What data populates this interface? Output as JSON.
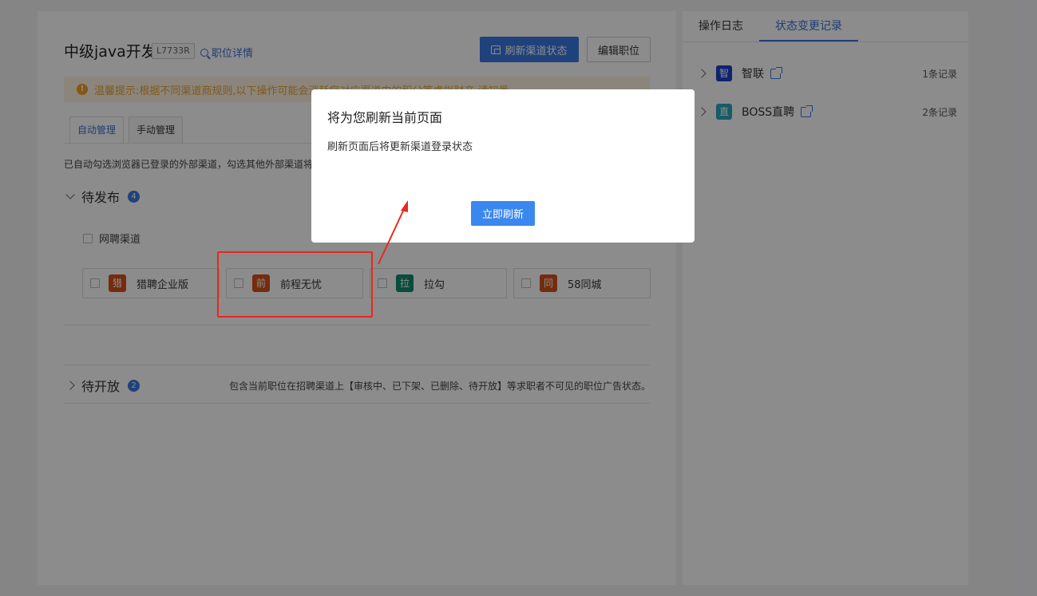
{
  "job": {
    "title": "中级java开发",
    "code": "L7733R",
    "detail_link": "职位详情",
    "refresh_button": "刷新渠道状态",
    "edit_button": "编辑职位"
  },
  "warning": {
    "text": "温馨提示:根据不同渠道商规则,以下操作可能会消耗您对应渠道中的积分等虚拟财产,请知悉。"
  },
  "tabs": [
    {
      "label": "自动管理",
      "active": true
    },
    {
      "label": "手动管理",
      "active": false
    }
  ],
  "auto_hint": "已自动勾选浏览器已登录的外部渠道，勾选其他外部渠道将",
  "pending": {
    "title": "待发布",
    "count": "4",
    "group_label": "网聘渠道",
    "channels": [
      {
        "icon": "猎",
        "name": "猎聘企业版",
        "color": "#d4501a"
      },
      {
        "icon": "前",
        "name": "前程无忧",
        "color": "#d4501a"
      },
      {
        "icon": "拉",
        "name": "拉勾",
        "color": "#0f8a6c"
      },
      {
        "icon": "同",
        "name": "58同城",
        "color": "#d4501a"
      }
    ]
  },
  "closed": {
    "title": "待开放",
    "count": "2",
    "description": "包含当前职位在招聘渠道上【审核中、已下架、已删除、待开放】等求职者不可见的职位广告状态。"
  },
  "side": {
    "tabs": [
      {
        "label": "操作日志",
        "active": false
      },
      {
        "label": "状态变更记录",
        "active": true
      }
    ],
    "records": [
      {
        "logo": "智",
        "name": "智联",
        "count": "1条记录",
        "color": "#1a3fc8"
      },
      {
        "logo": "直",
        "name": "BOSS直聘",
        "count": "2条记录",
        "color": "#2aa7b8"
      }
    ]
  },
  "modal": {
    "title": "将为您刷新当前页面",
    "body": "刷新页面后将更新渠道登录状态",
    "button": "立即刷新"
  }
}
